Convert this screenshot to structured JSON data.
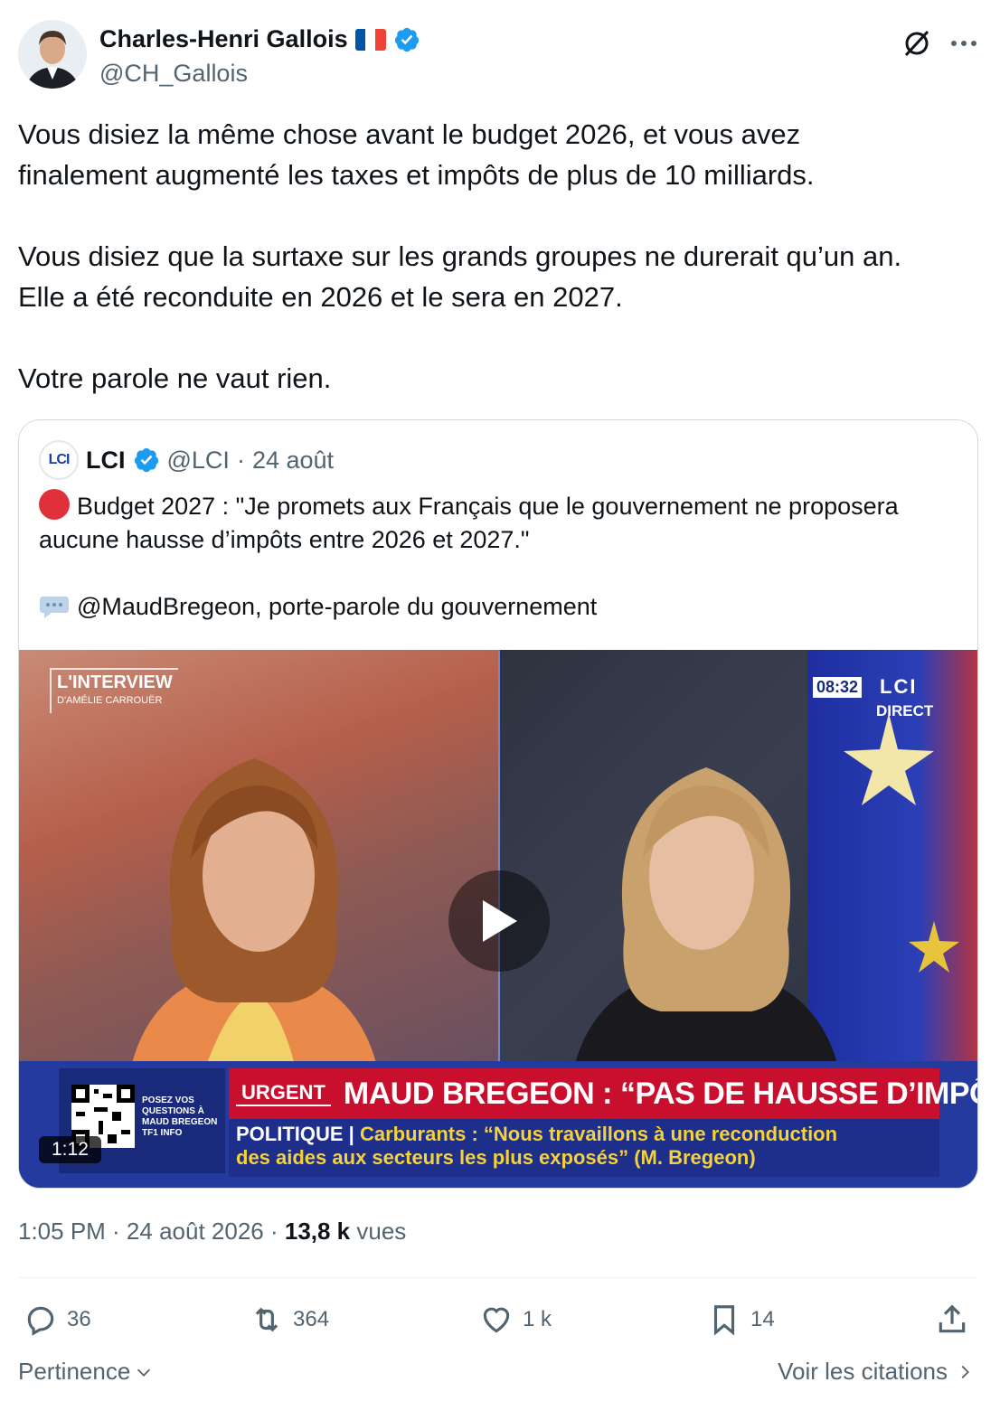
{
  "author": {
    "name": "Charles-Henri Gallois",
    "handle": "@CH_Gallois"
  },
  "tweet": {
    "text": "Vous disiez la même chose avant le budget 2026, et vous avez\nfinalement augmenté les taxes et impôts de plus de 10 milliards.\n\nVous disiez que la surtaxe sur les grands groupes ne durerait qu’un an.\nElle a été reconduite en 2026 et le sera en 2027.\n\nVotre parole ne vaut rien."
  },
  "quote": {
    "avatar_text": "LCI",
    "name": "LCI",
    "handle": "@LCI",
    "separator": "·",
    "date": "24 août",
    "line1": "Budget 2027 : \"Je promets aux Français que le gouvernement ne proposera aucune hausse d’impôts entre 2026 et 2027.\"",
    "line2": "@MaudBregeon, porte-parole du gouvernement",
    "video": {
      "duration": "1:12",
      "interview_logo": "L'INTERVIEW",
      "interview_logo_sub": "D'AMÉLIE CARROUËR",
      "clock": "08:32",
      "channel": "LCI",
      "live": "DIRECT",
      "qr_caption": "POSEZ VOS QUESTIONS À MAUD BREGEON",
      "qr_brand": "TF1 INFO",
      "urgent_label": "URGENT",
      "urgent_title": "MAUD BREGEON : “PAS DE HAUSSE D’IMPÔTS”",
      "info_category": "POLITIQUE |",
      "info_line1": "Carburants : “Nous travaillons à une reconduction",
      "info_line2": "des aides aux secteurs les plus exposés” (M. Bregeon)"
    }
  },
  "meta": {
    "time": "1:05 PM · 24 août 2026 · ",
    "views_count": "13,8 k",
    "views_label": "vues"
  },
  "actions": {
    "replies": "36",
    "reposts": "364",
    "likes": "1 k",
    "bookmarks": "14"
  },
  "footer": {
    "sort_label": "Pertinence",
    "quotes_label": "Voir les citations"
  },
  "colors": {
    "verified": "#1d9bf0",
    "text_secondary": "#536471",
    "border": "#cfd9de",
    "urgent_red": "#c8102e",
    "banner_blue": "#243a9e"
  }
}
